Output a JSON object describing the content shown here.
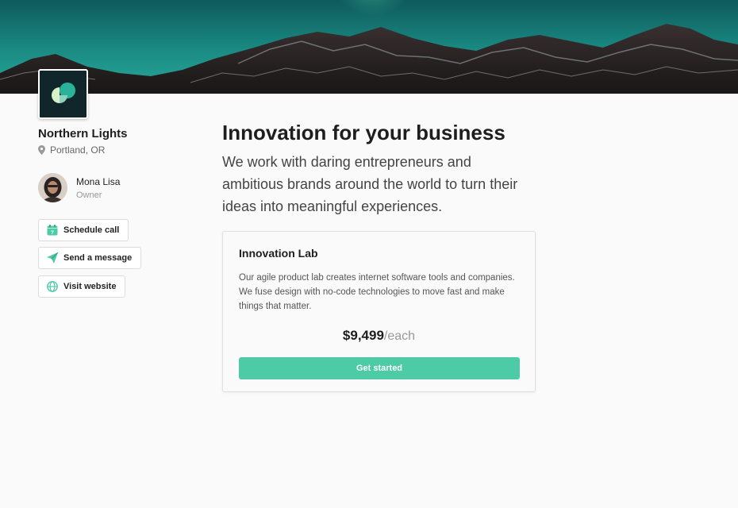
{
  "company": {
    "name": "Northern Lights",
    "location": "Portland, OR"
  },
  "owner": {
    "name": "Mona Lisa",
    "role": "Owner"
  },
  "actions": [
    {
      "label": "Schedule call",
      "icon": "calendar-icon"
    },
    {
      "label": "Send a message",
      "icon": "paper-plane-icon"
    },
    {
      "label": "Visit website",
      "icon": "globe-icon"
    }
  ],
  "main": {
    "headline": "Innovation for your business",
    "tagline": "We work with daring entrepreneurs and ambitious brands around the world to turn their ideas into meaningful experiences."
  },
  "offer": {
    "title": "Innovation Lab",
    "description": "Our agile product lab creates internet software tools and companies. We fuse design with no-code technologies to move fast and make things that matter.",
    "price": "$9,499",
    "unit": "/each",
    "cta": "Get started"
  },
  "colors": {
    "accent": "#4ccba6",
    "logo_bg": "#10262b"
  }
}
